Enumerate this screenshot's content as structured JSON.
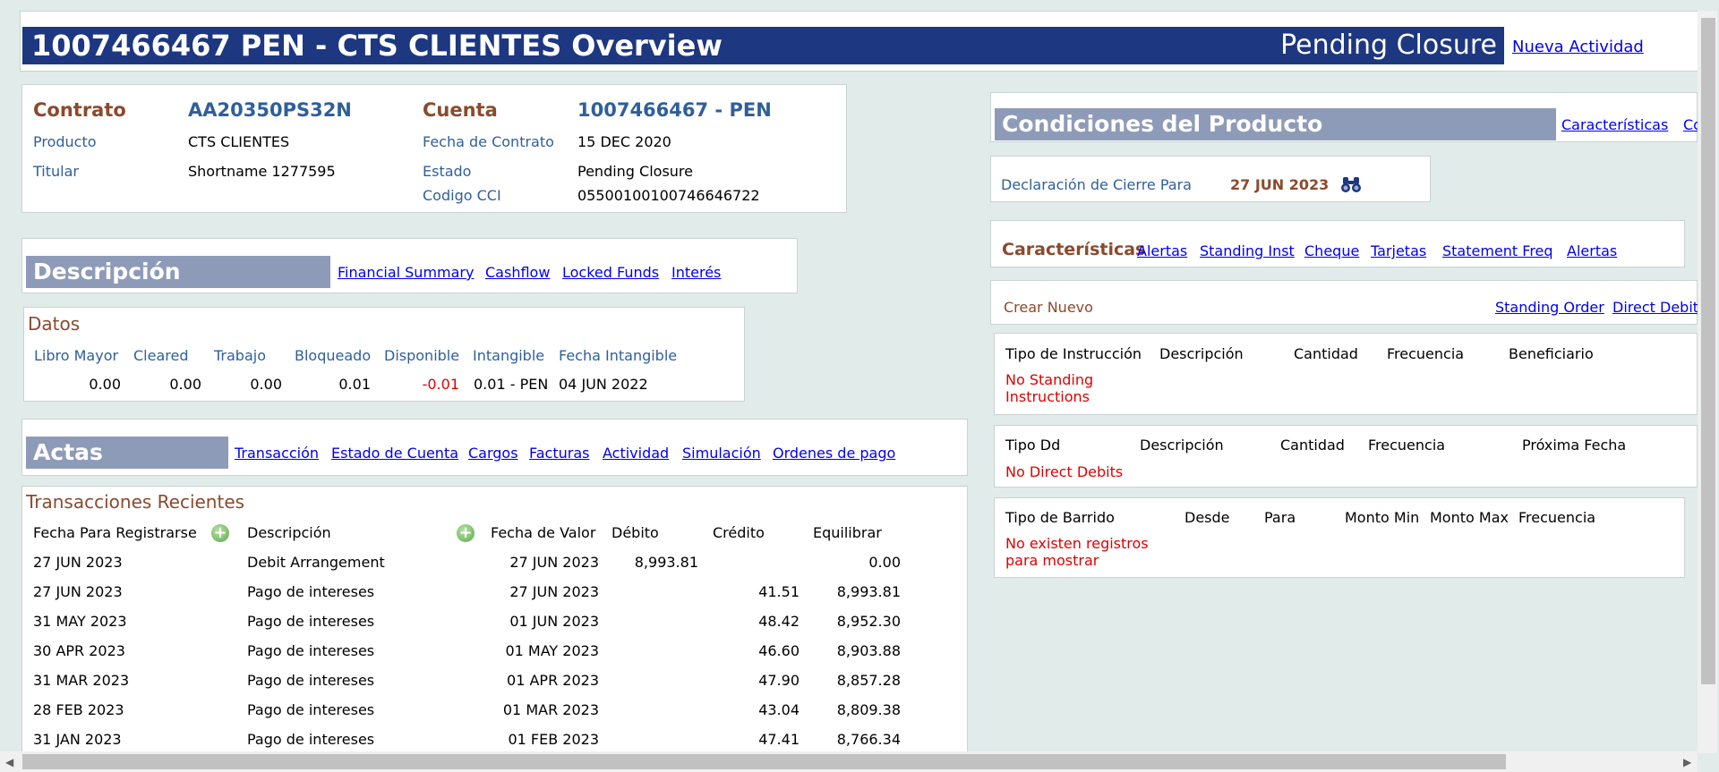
{
  "header": {
    "title": "1007466467 PEN - CTS CLIENTES Overview",
    "status": "Pending Closure",
    "new_activity": "Nueva Actividad"
  },
  "contract": {
    "contrato_label": "Contrato",
    "contrato_value": "AA20350PS32N",
    "cuenta_label": "Cuenta",
    "cuenta_value": "1007466467 - PEN",
    "producto_label": "Producto",
    "producto_value": "CTS CLIENTES",
    "fecha_contrato_label": "Fecha de Contrato",
    "fecha_contrato_value": "15 DEC 2020",
    "titular_label": "Titular",
    "titular_value": "Shortname 1277595",
    "estado_label": "Estado",
    "estado_value": "Pending Closure",
    "cci_label": "Codigo CCI",
    "cci_value": "05500100100746646722"
  },
  "descripcion": {
    "title": "Descripción",
    "links": [
      "Financial Summary",
      "Cashflow",
      "Locked Funds",
      "Interés"
    ]
  },
  "datos": {
    "title": "Datos",
    "headers": [
      "Libro Mayor",
      "Cleared",
      "Trabajo",
      "Bloqueado",
      "Disponible",
      "Intangible",
      "Fecha Intangible"
    ],
    "values": [
      "0.00",
      "0.00",
      "0.00",
      "0.01",
      "-0.01",
      "0.01 - PEN",
      "04 JUN 2022"
    ]
  },
  "actas": {
    "title": "Actas",
    "links": [
      "Transacción",
      "Estado de Cuenta",
      "Cargos",
      "Facturas",
      "Actividad",
      "Simulación",
      "Ordenes de pago"
    ]
  },
  "transacciones": {
    "title": "Transacciones Recientes",
    "headers": [
      "Fecha Para Registrarse",
      "Descripción",
      "Fecha de Valor",
      "Débito",
      "Crédito",
      "Equilibrar"
    ],
    "rows": [
      [
        "27 JUN 2023",
        "Debit Arrangement",
        "27 JUN 2023",
        "8,993.81",
        "",
        "0.00"
      ],
      [
        "27 JUN 2023",
        "Pago de intereses",
        "27 JUN 2023",
        "",
        "41.51",
        "8,993.81"
      ],
      [
        "31 MAY 2023",
        "Pago de intereses",
        "01 JUN 2023",
        "",
        "48.42",
        "8,952.30"
      ],
      [
        "30 APR 2023",
        "Pago de intereses",
        "01 MAY 2023",
        "",
        "46.60",
        "8,903.88"
      ],
      [
        "31 MAR 2023",
        "Pago de intereses",
        "01 APR 2023",
        "",
        "47.90",
        "8,857.28"
      ],
      [
        "28 FEB 2023",
        "Pago de intereses",
        "01 MAR 2023",
        "",
        "43.04",
        "8,809.38"
      ],
      [
        "31 JAN 2023",
        "Pago de intereses",
        "01 FEB 2023",
        "",
        "47.41",
        "8,766.34"
      ]
    ]
  },
  "condiciones": {
    "title": "Condiciones del Producto",
    "links": [
      "Características",
      "Co"
    ],
    "cierre_label": "Declaración de Cierre Para",
    "cierre_value": "27 JUN 2023",
    "binoculars_icon": "binoculars-icon"
  },
  "caracteristicas": {
    "title": "Características",
    "links": [
      "Alertas",
      "Standing Inst",
      "Cheque",
      "Tarjetas",
      "Statement Freq",
      "Alertas"
    ]
  },
  "crear": {
    "label": "Crear Nuevo",
    "links": [
      "Standing Order",
      "Direct Debit"
    ]
  },
  "standing": {
    "headers": [
      "Tipo de Instrucción",
      "Descripción",
      "Cantidad",
      "Frecuencia",
      "Beneficiario"
    ],
    "empty": "No Standing Instructions"
  },
  "direct_debits": {
    "headers": [
      "Tipo Dd",
      "Descripción",
      "Cantidad",
      "Frecuencia",
      "Próxima Fecha"
    ],
    "empty": "No Direct Debits"
  },
  "barrido": {
    "headers": [
      "Tipo de Barrido",
      "Desde",
      "Para",
      "Monto Min",
      "Monto Max",
      "Frecuencia"
    ],
    "empty": "No existen registros para mostrar"
  }
}
